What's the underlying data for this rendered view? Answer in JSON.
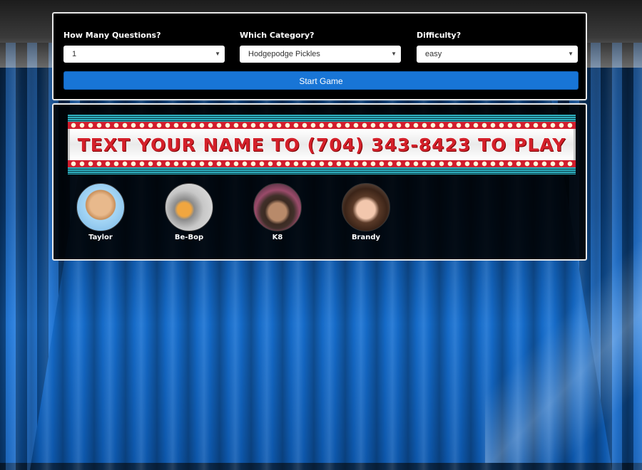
{
  "controls": {
    "questions": {
      "label": "How Many Questions?",
      "value": "1"
    },
    "category": {
      "label": "Which Category?",
      "value": "Hodgepodge Pickles"
    },
    "difficulty": {
      "label": "Difficulty?",
      "value": "easy"
    },
    "start_label": "Start Game"
  },
  "banner": {
    "text": "TEXT YOUR NAME TO (704) 343-8423 TO PLAY"
  },
  "players": [
    {
      "name": "Taylor"
    },
    {
      "name": "Be-Bop"
    },
    {
      "name": "K8"
    },
    {
      "name": "Brandy"
    }
  ],
  "colors": {
    "accent": "#1875d6",
    "sign_text": "#d4202a",
    "bulb_bar": "#d11d2d",
    "stripe": "#2fb1c1"
  }
}
